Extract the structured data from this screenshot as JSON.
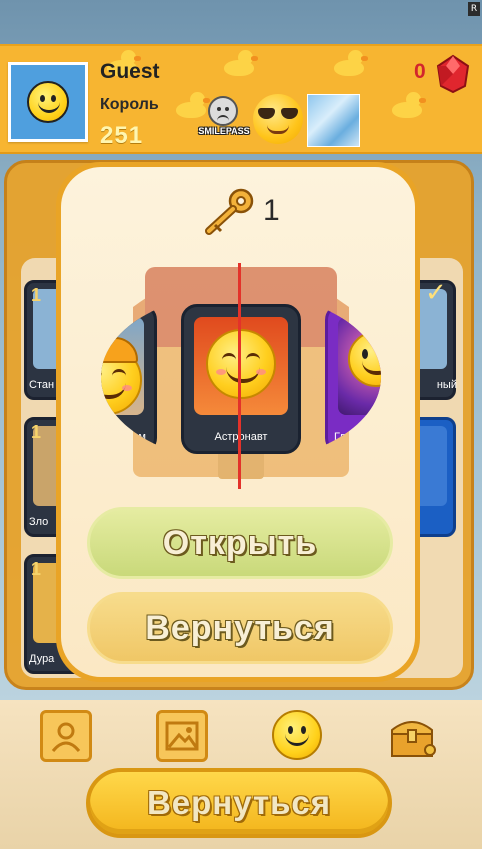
{
  "header": {
    "username": "Guest",
    "rank": "Король",
    "score": "251",
    "smilepass_label": "SMILEPASS",
    "gems": "0"
  },
  "background_cards": [
    {
      "count": "1",
      "name": "Стан"
    },
    {
      "count": "1",
      "name": "Зло"
    },
    {
      "count": "1",
      "name": "Дура"
    },
    {
      "count": "",
      "name": "ный"
    }
  ],
  "modal": {
    "key_count": "1",
    "reel": [
      {
        "name": "ом",
        "icon": "builder-emoji-icon"
      },
      {
        "name": "Астронавт",
        "icon": "astronaut-emoji-icon"
      },
      {
        "name": "Гл",
        "icon": "galaxy-emoji-icon"
      }
    ],
    "open_label": "Открыть",
    "back_label": "Вернуться"
  },
  "bottom": {
    "back_label": "Вернуться",
    "nav": [
      "profile-icon",
      "gallery-icon",
      "smiley-icon",
      "treasure-chest-icon"
    ]
  },
  "colors": {
    "header_bg": "#f7b531",
    "gem_red": "#d3262c",
    "modal_border": "#e9a426",
    "open_button": "#c9d97a",
    "back_button": "#f0c766",
    "reel_line": "#e3322a"
  }
}
